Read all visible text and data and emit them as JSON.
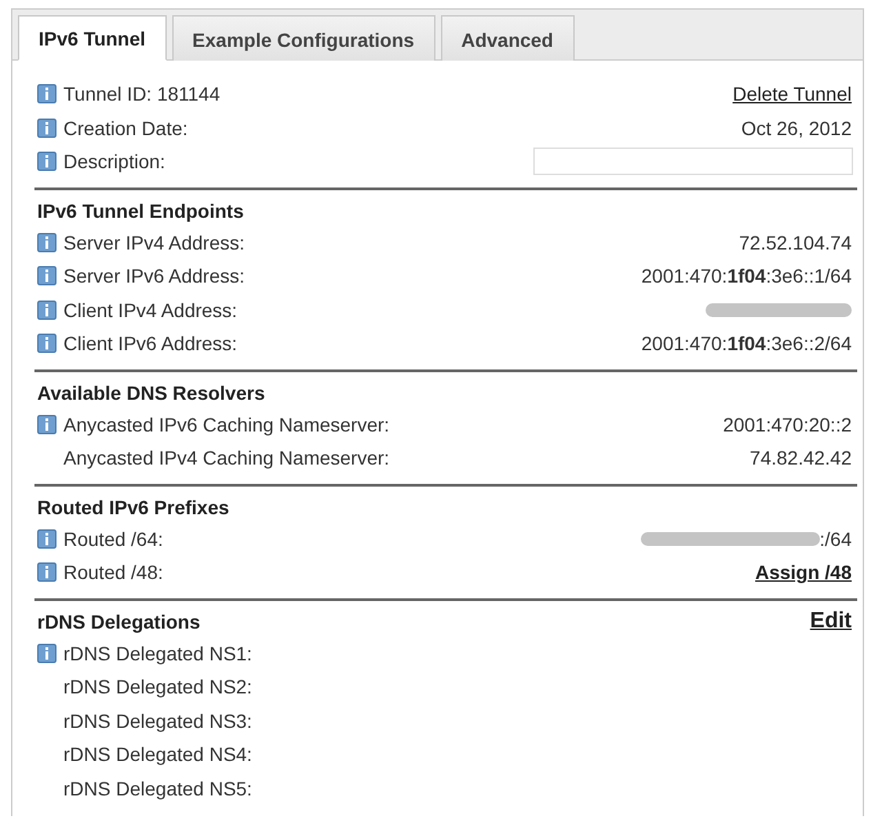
{
  "tabs": [
    {
      "label": "IPv6 Tunnel",
      "selected": true
    },
    {
      "label": "Example Configurations",
      "selected": false
    },
    {
      "label": "Advanced",
      "selected": false
    }
  ],
  "sections": [
    {
      "rows": [
        {
          "label": "Tunnel ID: 181144",
          "info": true,
          "kind": "link",
          "value": "Delete Tunnel"
        },
        {
          "label": "Creation Date:",
          "info": true,
          "kind": "text",
          "value": "Oct 26, 2012"
        },
        {
          "label": "Description:",
          "info": true,
          "kind": "field"
        }
      ]
    },
    {
      "title": "IPv6 Tunnel Endpoints",
      "rows": [
        {
          "label": "Server IPv4 Address:",
          "info": true,
          "kind": "text",
          "value": "72.52.104.74"
        },
        {
          "label": "Server IPv6 Address:",
          "info": true,
          "kind": "text",
          "value": "2001:470:**1f04**:3e6::1/64"
        },
        {
          "label": "Client IPv4 Address:",
          "info": true,
          "kind": "redacted-link"
        },
        {
          "label": "Client IPv6 Address:",
          "info": true,
          "kind": "text",
          "value": "2001:470:**1f04**:3e6::2/64"
        }
      ]
    },
    {
      "title": "Available DNS Resolvers",
      "rows": [
        {
          "label": "Anycasted IPv6 Caching Nameserver:",
          "info": true,
          "kind": "text",
          "value": "2001:470:20::2"
        },
        {
          "label": "Anycasted IPv4 Caching Nameserver:",
          "info": false,
          "kind": "text",
          "value": "74.82.42.42"
        }
      ]
    },
    {
      "title": "Routed IPv6 Prefixes",
      "rows": [
        {
          "label": "Routed /64:",
          "info": true,
          "kind": "redacted",
          "value": ":/64"
        },
        {
          "label": "Routed /48:",
          "info": true,
          "kind": "bold-link",
          "value": "Assign /48"
        }
      ]
    },
    {
      "title": "rDNS Delegations",
      "action": "Edit",
      "rows": [
        {
          "label": "rDNS Delegated NS1:",
          "info": true,
          "kind": "text"
        },
        {
          "label": "rDNS Delegated NS2:",
          "info": false,
          "kind": "text"
        },
        {
          "label": "rDNS Delegated NS3:",
          "info": false,
          "kind": "text"
        },
        {
          "label": "rDNS Delegated NS4:",
          "info": false,
          "kind": "text"
        },
        {
          "label": "rDNS Delegated NS5:",
          "info": false,
          "kind": "text"
        }
      ]
    }
  ]
}
